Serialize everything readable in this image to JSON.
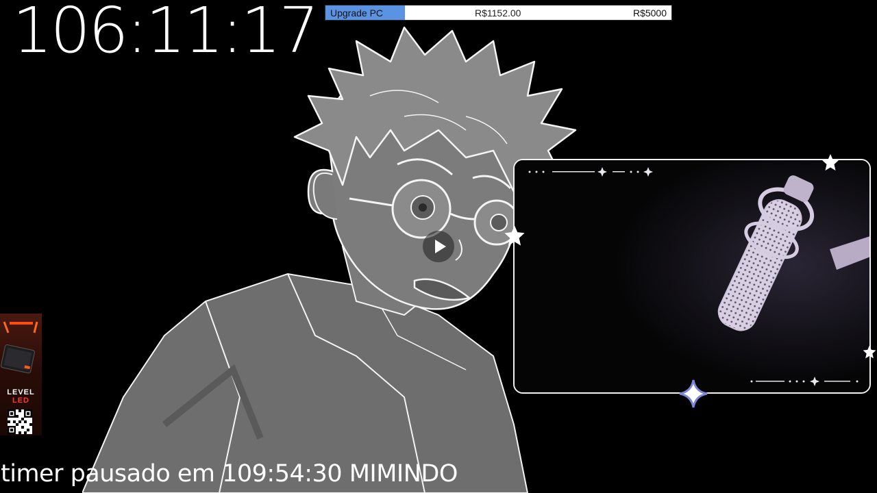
{
  "timer": {
    "display": "106:11:17"
  },
  "goal": {
    "label": "Upgrade PC",
    "current": "R$1152.00",
    "target": "R$5000",
    "progress_fraction": 0.2304,
    "fill_color": "#5b93e4"
  },
  "player": {
    "play_icon": "play-icon"
  },
  "sponsor": {
    "brand_line1": "LEVEL",
    "brand_line2": "LED"
  },
  "status": {
    "text": "timer pausado em 109:54:30 MIMINDO"
  },
  "colors": {
    "background": "#000000",
    "text": "#ffffff",
    "frame": "#f2f2f2",
    "star_accent": "#7d86d8"
  }
}
